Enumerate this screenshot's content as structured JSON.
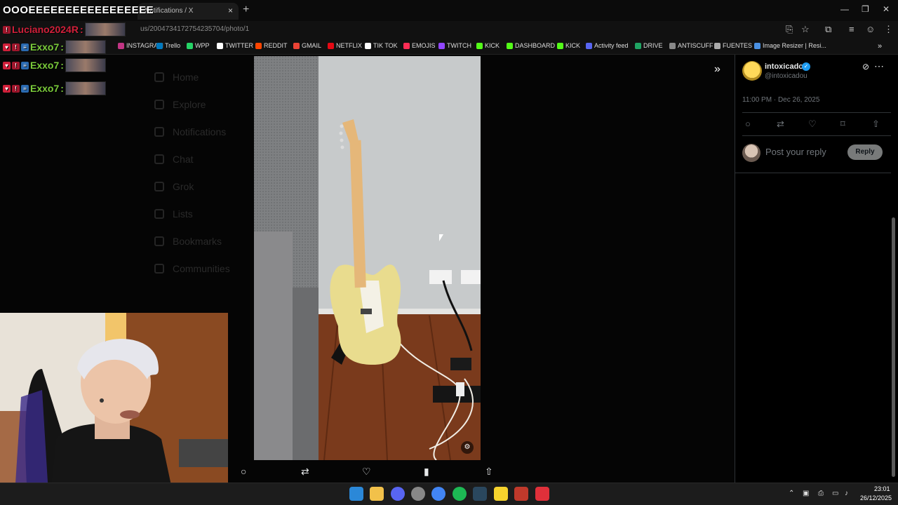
{
  "browser": {
    "tab_title": "Notifications / X",
    "url": "us/2004734172754235704/photo/1",
    "bookmarks": [
      {
        "label": "INSTAGRAM",
        "color": "#c13584"
      },
      {
        "label": "Trello",
        "color": "#0079bf"
      },
      {
        "label": "WPP",
        "color": "#25d366"
      },
      {
        "label": "TWITTER",
        "color": "#ffffff"
      },
      {
        "label": "REDDIT",
        "color": "#ff4500"
      },
      {
        "label": "GMAIL",
        "color": "#ea4335"
      },
      {
        "label": "NETFLIX",
        "color": "#e50914"
      },
      {
        "label": "TIK TOK",
        "color": "#ffffff"
      },
      {
        "label": "EMOJIS",
        "color": "#ff2d55"
      },
      {
        "label": "TWITCH",
        "color": "#9146ff"
      },
      {
        "label": "KICK",
        "color": "#53fc18"
      },
      {
        "label": "DASHBOARD",
        "color": "#53fc18"
      },
      {
        "label": "KICK",
        "color": "#53fc18"
      },
      {
        "label": "Activity feed",
        "color": "#5865f2"
      },
      {
        "label": "DRIVE",
        "color": "#1fa463"
      },
      {
        "label": "ANTISCUFF",
        "color": "#888888"
      },
      {
        "label": "FUENTES",
        "color": "#aaaaaa"
      },
      {
        "label": "Image Resizer | Resi...",
        "color": "#4a90e2"
      }
    ]
  },
  "stream_overlay": {
    "title": "OOOEEEEEEEEEEEEEEEEE",
    "chat": [
      {
        "user": "Luciano2024R",
        "color": "#d0203a"
      },
      {
        "user": "Exxo7",
        "color": "#7acb3a"
      },
      {
        "user": "Exxo7",
        "color": "#7acb3a"
      },
      {
        "user": "Exxo7",
        "color": "#7acb3a"
      }
    ]
  },
  "sidebar_faded": [
    "Home",
    "Explore",
    "Notifications",
    "Chat",
    "Grok",
    "Lists",
    "Bookmarks",
    "Communities"
  ],
  "media_actions": [
    "reply-icon",
    "repost-icon",
    "like-icon",
    "views-icon",
    "share-icon"
  ],
  "post": {
    "author_name": "intoxicado",
    "handle": "@intoxicadou",
    "timestamp": "11:00 PM · Dec 26, 2025",
    "reply_placeholder": "Post your reply",
    "reply_button": "Reply"
  },
  "taskbar": {
    "time": "23:01",
    "date": "26/12/2025"
  }
}
